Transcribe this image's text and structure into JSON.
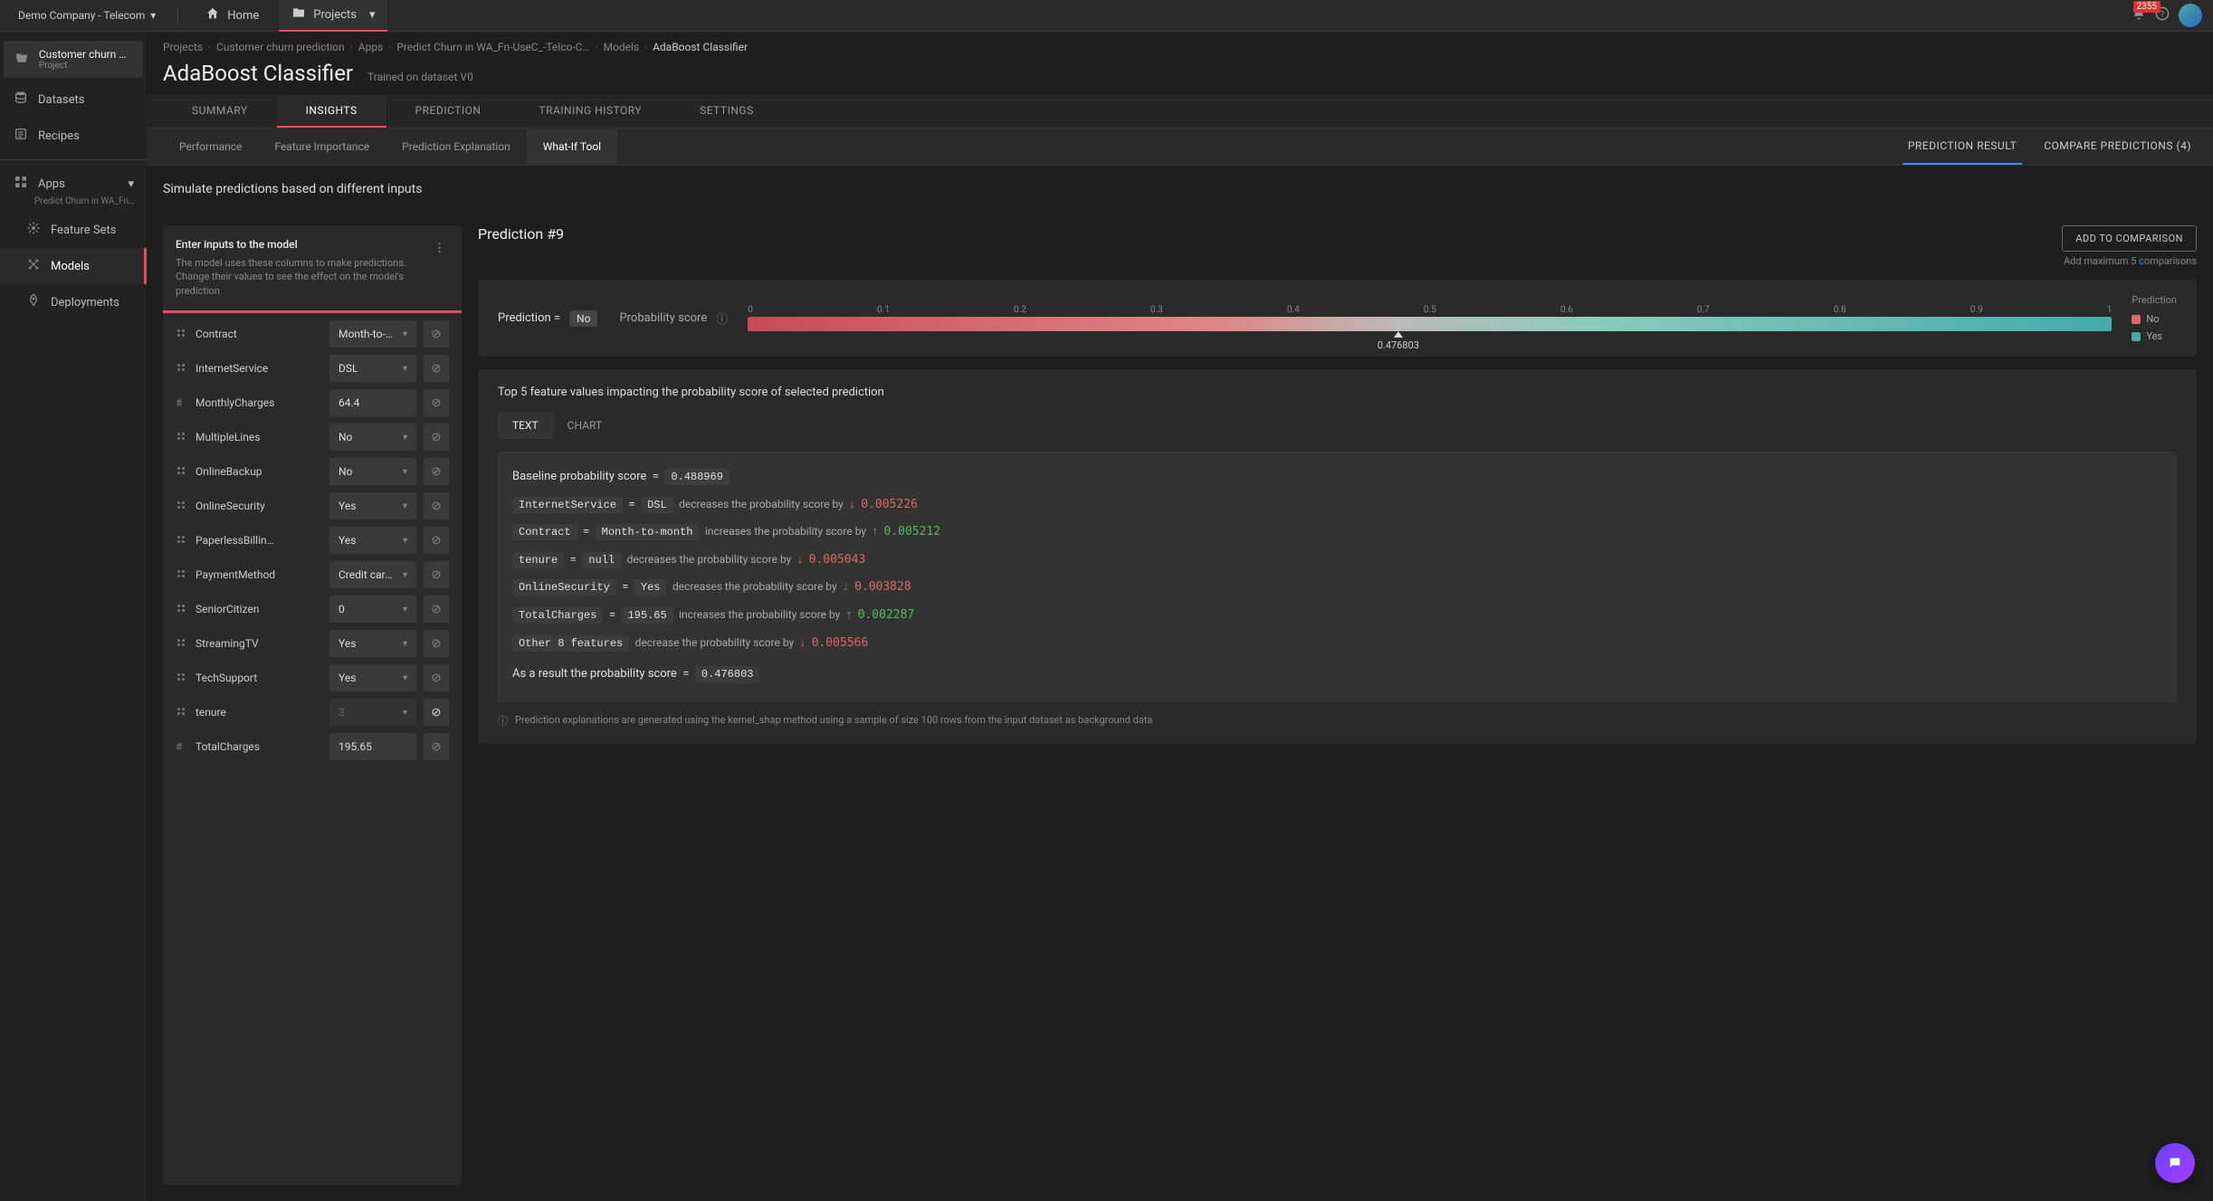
{
  "topbar": {
    "company": "Demo Company - Telecom",
    "home": "Home",
    "projects": "Projects",
    "notif_count": "2355"
  },
  "sidebar": {
    "project_name": "Customer churn pred…",
    "project_sub": "Project",
    "datasets": "Datasets",
    "recipes": "Recipes",
    "apps": "Apps",
    "apps_sub": "Predict Churn in WA_Fn-UseC_…",
    "feature_sets": "Feature Sets",
    "models": "Models",
    "deployments": "Deployments"
  },
  "breadcrumbs": [
    "Projects",
    "Customer churn prediction",
    "Apps",
    "Predict Churn in WA_Fn-UseC_-Telco-C…",
    "Models",
    "AdaBoost Classifier"
  ],
  "page": {
    "title": "AdaBoost Classifier",
    "sub": "Trained on dataset V0"
  },
  "tabs_main": [
    "SUMMARY",
    "INSIGHTS",
    "PREDICTION",
    "TRAINING HISTORY",
    "SETTINGS"
  ],
  "tabs_main_active": 1,
  "subtabs": [
    "Performance",
    "Feature Importance",
    "Prediction Explanation",
    "What-If Tool"
  ],
  "subtabs_active": 3,
  "subtabs_right": {
    "result": "PREDICTION RESULT",
    "compare": "COMPARE PREDICTIONS (4)"
  },
  "simulate_title": "Simulate predictions based on different inputs",
  "left": {
    "heading": "Enter inputs to the model",
    "desc": "The model uses these columns to make predictions. Change their values to see the effect on the model's prediction",
    "rows": [
      {
        "icon": "cat",
        "label": "Contract",
        "type": "select",
        "value": "Month-to-m…"
      },
      {
        "icon": "cat",
        "label": "InternetService",
        "type": "select",
        "value": "DSL"
      },
      {
        "icon": "num",
        "label": "MonthlyCharges",
        "type": "text",
        "value": "64.4"
      },
      {
        "icon": "cat",
        "label": "MultipleLines",
        "type": "select",
        "value": "No"
      },
      {
        "icon": "cat",
        "label": "OnlineBackup",
        "type": "select",
        "value": "No"
      },
      {
        "icon": "cat",
        "label": "OnlineSecurity",
        "type": "select",
        "value": "Yes"
      },
      {
        "icon": "cat",
        "label": "PaperlessBillin…",
        "type": "select",
        "value": "Yes"
      },
      {
        "icon": "cat",
        "label": "PaymentMethod",
        "type": "select",
        "value": "Credit card …"
      },
      {
        "icon": "cat",
        "label": "SeniorCitizen",
        "type": "select",
        "value": "0"
      },
      {
        "icon": "cat",
        "label": "StreamingTV",
        "type": "select",
        "value": "Yes"
      },
      {
        "icon": "cat",
        "label": "TechSupport",
        "type": "select",
        "value": "Yes"
      },
      {
        "icon": "cat",
        "label": "tenure",
        "type": "select",
        "value": "3",
        "disabled": true,
        "reset_active": true
      },
      {
        "icon": "num",
        "label": "TotalCharges",
        "type": "text",
        "value": "195.65"
      }
    ]
  },
  "right": {
    "pred_title": "Prediction #9",
    "add_btn": "ADD TO COMPARISON",
    "add_note_pre": "Add maximum 5 ",
    "add_note_hl": "c",
    "add_note_post": "omparisons",
    "score": {
      "label_pre": "Prediction =",
      "chip": "No",
      "prob_label": "Probability score",
      "ticks": [
        "0",
        "0.1",
        "0.2",
        "0.3",
        "0.4",
        "0.5",
        "0.6",
        "0.7",
        "0.8",
        "0.9",
        "1"
      ],
      "marker_pct": 47.68,
      "marker_val": "0.476803",
      "legend_title": "Prediction",
      "legend_no": "No",
      "legend_yes": "Yes"
    },
    "impact": {
      "title": "Top 5 feature values impacting the probability score of selected prediction",
      "tab_text": "TEXT",
      "tab_chart": "CHART",
      "baseline_label": "Baseline probability score",
      "baseline_eq": "=",
      "baseline_val": "0.488969",
      "rows": [
        {
          "feat": "InternetService",
          "eq": "=",
          "val": "DSL",
          "phrase": "decreases the probability score by",
          "dir": "down",
          "delta": "0.005226"
        },
        {
          "feat": "Contract",
          "eq": "=",
          "val": "Month-to-month",
          "phrase": "increases the probability score by",
          "dir": "up",
          "delta": "0.005212"
        },
        {
          "feat": "tenure",
          "eq": "=",
          "val": "null",
          "phrase": "decreases the probability score by",
          "dir": "down",
          "delta": "0.005043"
        },
        {
          "feat": "OnlineSecurity",
          "eq": "=",
          "val": "Yes",
          "phrase": "decreases the probability score by",
          "dir": "down",
          "delta": "0.003828"
        },
        {
          "feat": "TotalCharges",
          "eq": "=",
          "val": "195.65",
          "phrase": "increases the probability score by",
          "dir": "up",
          "delta": "0.002287"
        }
      ],
      "other_label": "Other 8 features",
      "other_phrase": "decrease the probability score by",
      "other_delta": "0.005566",
      "result_label": "As a result the probability score",
      "result_eq": "=",
      "result_val": "0.476803",
      "note": "Prediction explanations are generated using the kernel_shap method using a sample of size 100 rows from the input dataset as background data"
    }
  }
}
